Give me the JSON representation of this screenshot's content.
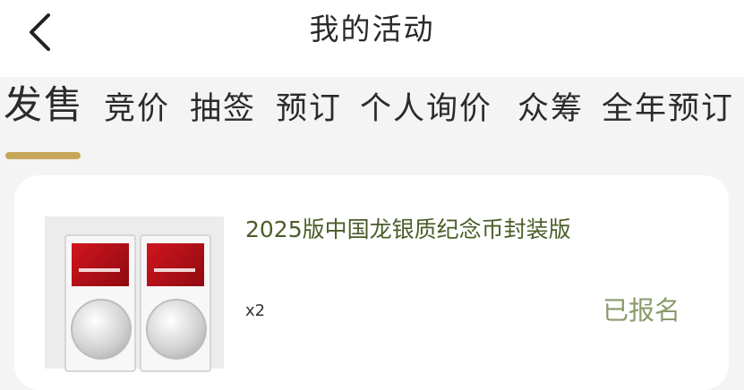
{
  "header": {
    "title": "我的活动",
    "back_icon": "chevron-left-icon"
  },
  "tabs": [
    {
      "label": "发售",
      "active": true
    },
    {
      "label": "竞价",
      "active": false
    },
    {
      "label": "抽签",
      "active": false
    },
    {
      "label": "预订",
      "active": false
    },
    {
      "label": "个人询价",
      "active": false
    },
    {
      "label": "众筹",
      "active": false
    },
    {
      "label": "全年预订",
      "active": false
    }
  ],
  "activities": [
    {
      "name": "2025版中国龙银质纪念币封装版",
      "quantity": "x2",
      "status": "已报名"
    }
  ],
  "colors": {
    "accent_underline": "#c8a75a",
    "product_name": "#4b5d29",
    "status_text": "#8a9a6c"
  }
}
